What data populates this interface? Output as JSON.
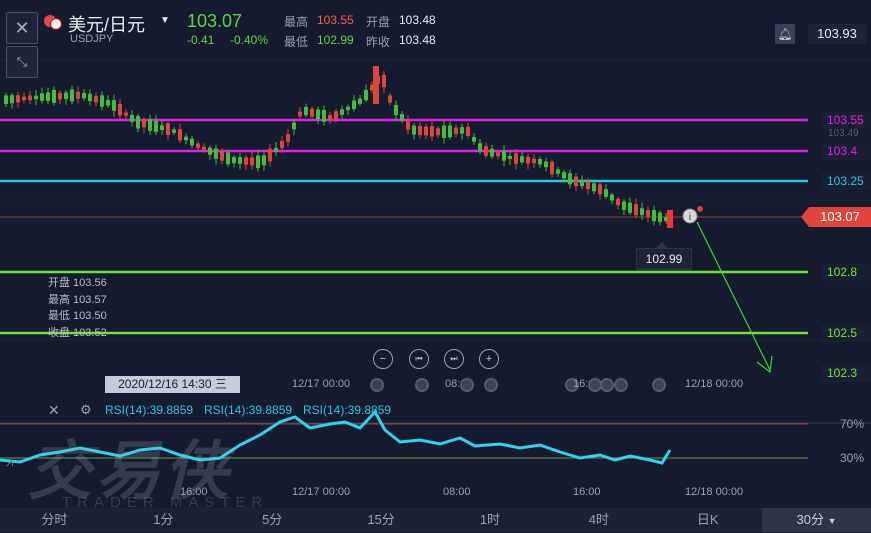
{
  "header": {
    "pair_name": "美元/日元",
    "pair_code": "USDJPY",
    "price": "103.07",
    "change": "-0.41",
    "change_pct": "-0.40%",
    "high_label": "最高",
    "high_value": "103.55",
    "open_label": "开盘",
    "open_value": "103.48",
    "low_label": "最低",
    "low_value": "102.99",
    "prev_label": "昨收",
    "prev_value": "103.48",
    "right_price": "103.93"
  },
  "levels": [
    {
      "label": "103.55",
      "color": "#e020e8"
    },
    {
      "label": "103.4",
      "color": "#e020e8"
    },
    {
      "label": "103.25",
      "color": "#2fc3e0"
    },
    {
      "label": "102.8",
      "color": "#6fe23a"
    },
    {
      "label": "102.5",
      "color": "#6fe23a"
    },
    {
      "label": "102.3",
      "color": "#6fe23a"
    }
  ],
  "axis_prices": {
    "p1": "103.49",
    "p2": "102.99"
  },
  "current_price_tag": "103.07",
  "low_marker": "102.99",
  "ohlc_popup": {
    "open": "开盘 103.56",
    "high": "最高 103.57",
    "low": "最低 103.50",
    "close": "收盘 103.52"
  },
  "cursor_time": "2020/12/16 14:30 三",
  "time_labels": {
    "t1": "12/17 00:00",
    "t2": "08:00",
    "t3": "16:00",
    "t4": "12/18 00:00"
  },
  "rsi": {
    "label": "RSI(14):39.8859",
    "level_high": "70%",
    "level_low": "30%"
  },
  "sub_time_labels": {
    "t0": "16:00",
    "t1": "12/17 00:00",
    "t2": "08:00",
    "t3": "16:00",
    "t4": "12/18 00:00"
  },
  "watermark": {
    "text": "交易侠",
    "sub": "TRADER MASTER"
  },
  "tabs": [
    "分时",
    "1分",
    "5分",
    "15分",
    "1时",
    "4时",
    "日K",
    "30分"
  ]
}
